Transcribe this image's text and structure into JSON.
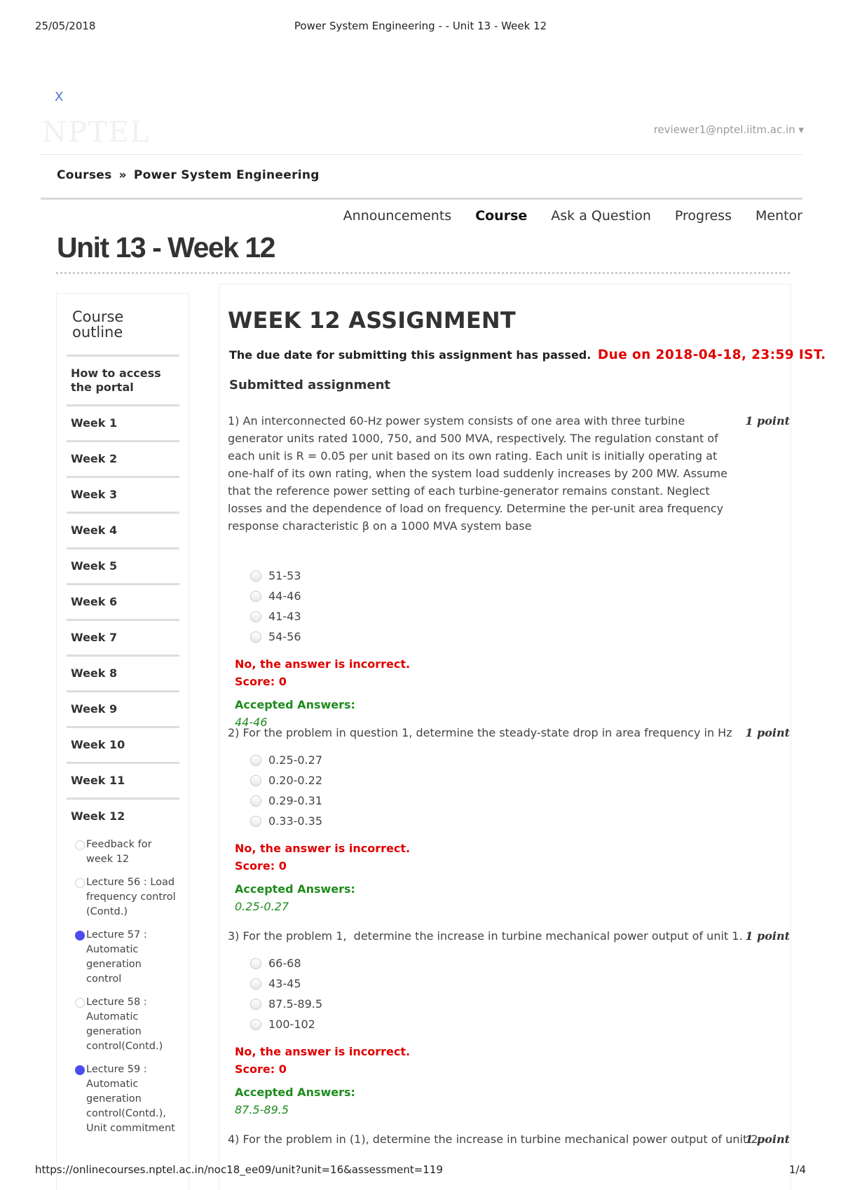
{
  "print_header": {
    "date": "25/05/2018",
    "title": "Power System Engineering - - Unit 13 - Week 12"
  },
  "top": {
    "close_label": "X",
    "logo_text": "NPTEL",
    "user_email": "reviewer1@nptel.iitm.ac.in",
    "user_caret": "▾"
  },
  "breadcrumb": {
    "root": "Courses",
    "sep": "»",
    "course": "Power System Engineering"
  },
  "tabs": [
    "Announcements",
    "Course",
    "Ask a Question",
    "Progress",
    "Mentor"
  ],
  "active_tab": "Course",
  "page_title": "Unit 13 - Week 12",
  "sidebar": {
    "title_line1": "Course",
    "title_line2": "outline",
    "items": [
      "How to access the portal",
      "Week 1",
      "Week 2",
      "Week 3",
      "Week 4",
      "Week 5",
      "Week 6",
      "Week 7",
      "Week 8",
      "Week 9",
      "Week 10",
      "Week 11",
      "Week 12"
    ],
    "lessons": [
      {
        "label": "Feedback for week 12",
        "status": "empty"
      },
      {
        "label": "Lecture 56 : Load frequency control (Contd.)",
        "status": "empty"
      },
      {
        "label": "Lecture 57 : Automatic generation control",
        "status": "filled"
      },
      {
        "label": "Lecture 58 : Automatic generation control(Contd.)",
        "status": "empty"
      },
      {
        "label": "Lecture 59 : Automatic generation control(Contd.), Unit commitment",
        "status": "filled"
      }
    ]
  },
  "assignment": {
    "title": "WEEK 12 ASSIGNMENT",
    "due_text": "The due date for submitting this assignment has passed.",
    "due_date": "Due on 2018-04-18, 23:59 IST.",
    "submitted_label": "Submitted assignment",
    "point_label": "1 point",
    "wrong_text": "No, the answer is incorrect.",
    "score_text": "Score: 0",
    "accepted_label": "Accepted Answers:",
    "questions": [
      {
        "text": "1) An interconnected 60-Hz power system consists of one area with three turbine generator units rated 1000, 750, and 500 MVA, respectively. The regulation constant of each unit is R = 0.05 per unit based on its own rating. Each unit is initially operating at one-half of its own rating, when the system load suddenly increases by 200 MW. Assume that the reference power setting of each turbine-generator remains constant. Neglect losses and the dependence of load on frequency. Determine the per-unit area frequency response characteristic β on a 1000 MVA system base",
        "options": [
          "51-53",
          "44-46",
          "41-43",
          "54-56"
        ],
        "answer": "44-46"
      },
      {
        "text": "2) For the problem in question 1, determine the steady-state drop in area frequency in Hz",
        "options": [
          "0.25-0.27",
          "0.20-0.22",
          "0.29-0.31",
          "0.33-0.35"
        ],
        "answer": "0.25-0.27"
      },
      {
        "text": "3) For the problem 1,  determine the increase in turbine mechanical power output of unit 1.",
        "options": [
          "66-68",
          "43-45",
          "87.5-89.5",
          "100-102"
        ],
        "answer": "87.5-89.5"
      },
      {
        "text": "4) For the problem in (1), determine the increase in turbine mechanical power output of unit 2."
      }
    ]
  },
  "print_footer": {
    "url": "https://onlinecourses.nptel.ac.in/noc18_ee09/unit?unit=16&assessment=119",
    "page": "1/4"
  }
}
